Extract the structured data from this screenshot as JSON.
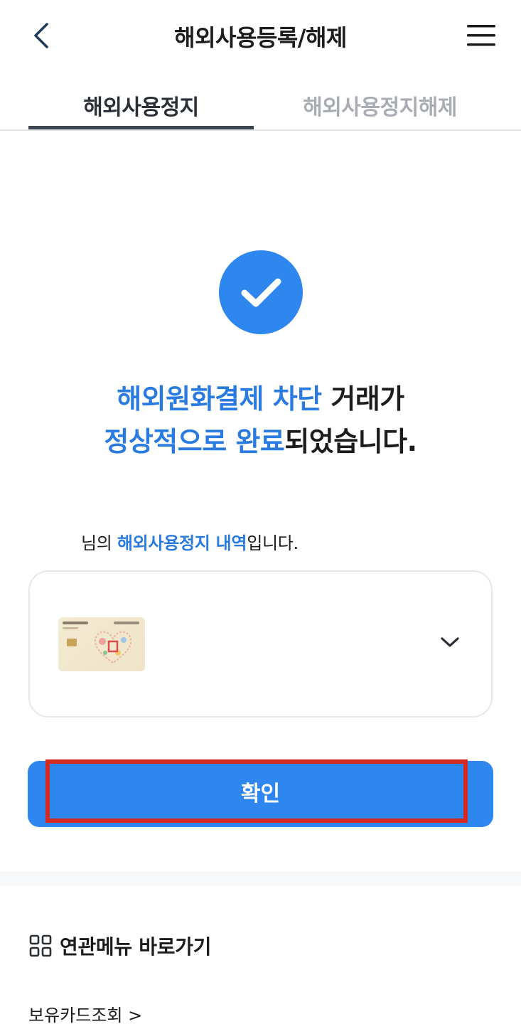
{
  "header": {
    "title": "해외사용등록/해제",
    "back_icon": "chevron-left-icon",
    "menu_icon": "hamburger-menu-icon"
  },
  "tabs": [
    {
      "label": "해외사용정지",
      "active": true
    },
    {
      "label": "해외사용정지해제",
      "active": false
    }
  ],
  "result": {
    "line1_highlight": "해외원화결제 차단",
    "line1_rest": " 거래가",
    "line2_highlight": "정상적으로 완료",
    "line2_rest": "되었습니다."
  },
  "history": {
    "prefix": "님의 ",
    "highlight": "해외사용정지 내역",
    "suffix": "입니다."
  },
  "card_select": {
    "chevron_icon": "chevron-down-icon"
  },
  "confirm_button": {
    "label": "확인"
  },
  "related_menu": {
    "title": "연관메뉴 바로가기",
    "icon": "grid-icon",
    "first_link": "보유카드조회 >"
  },
  "colors": {
    "accent": "#2e86ef",
    "highlight_text": "#2a7be0",
    "annotation_box": "#d32b21",
    "inactive_tab": "#a9adb3"
  }
}
